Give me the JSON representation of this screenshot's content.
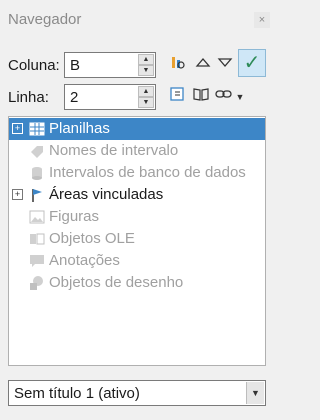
{
  "window": {
    "title": "Navegador",
    "close_label": "×"
  },
  "nav": {
    "column_label": "Coluna:",
    "column_value": "B",
    "row_label": "Linha:",
    "row_value": "2"
  },
  "tree": {
    "items": [
      {
        "label": "Planilhas",
        "icon": "sheet-icon",
        "expandable": true,
        "disabled": false,
        "selected": true
      },
      {
        "label": "Nomes de intervalo",
        "icon": "range-name-icon",
        "expandable": false,
        "disabled": true,
        "selected": false
      },
      {
        "label": "Intervalos de banco de dados",
        "icon": "database-icon",
        "expandable": false,
        "disabled": true,
        "selected": false
      },
      {
        "label": "Áreas vinculadas",
        "icon": "linked-area-icon",
        "expandable": true,
        "disabled": false,
        "selected": false
      },
      {
        "label": "Figuras",
        "icon": "image-icon",
        "expandable": false,
        "disabled": true,
        "selected": false
      },
      {
        "label": "Objetos OLE",
        "icon": "ole-object-icon",
        "expandable": false,
        "disabled": true,
        "selected": false
      },
      {
        "label": "Anotações",
        "icon": "comment-icon",
        "expandable": false,
        "disabled": true,
        "selected": false
      },
      {
        "label": "Objetos de desenho",
        "icon": "drawing-object-icon",
        "expandable": false,
        "disabled": true,
        "selected": false
      }
    ]
  },
  "document_select": {
    "value": "Sem título 1 (ativo)"
  },
  "colors": {
    "selection": "#3d86c7",
    "disabled_text": "#a0a0a0",
    "check_green": "#2e8b57"
  }
}
